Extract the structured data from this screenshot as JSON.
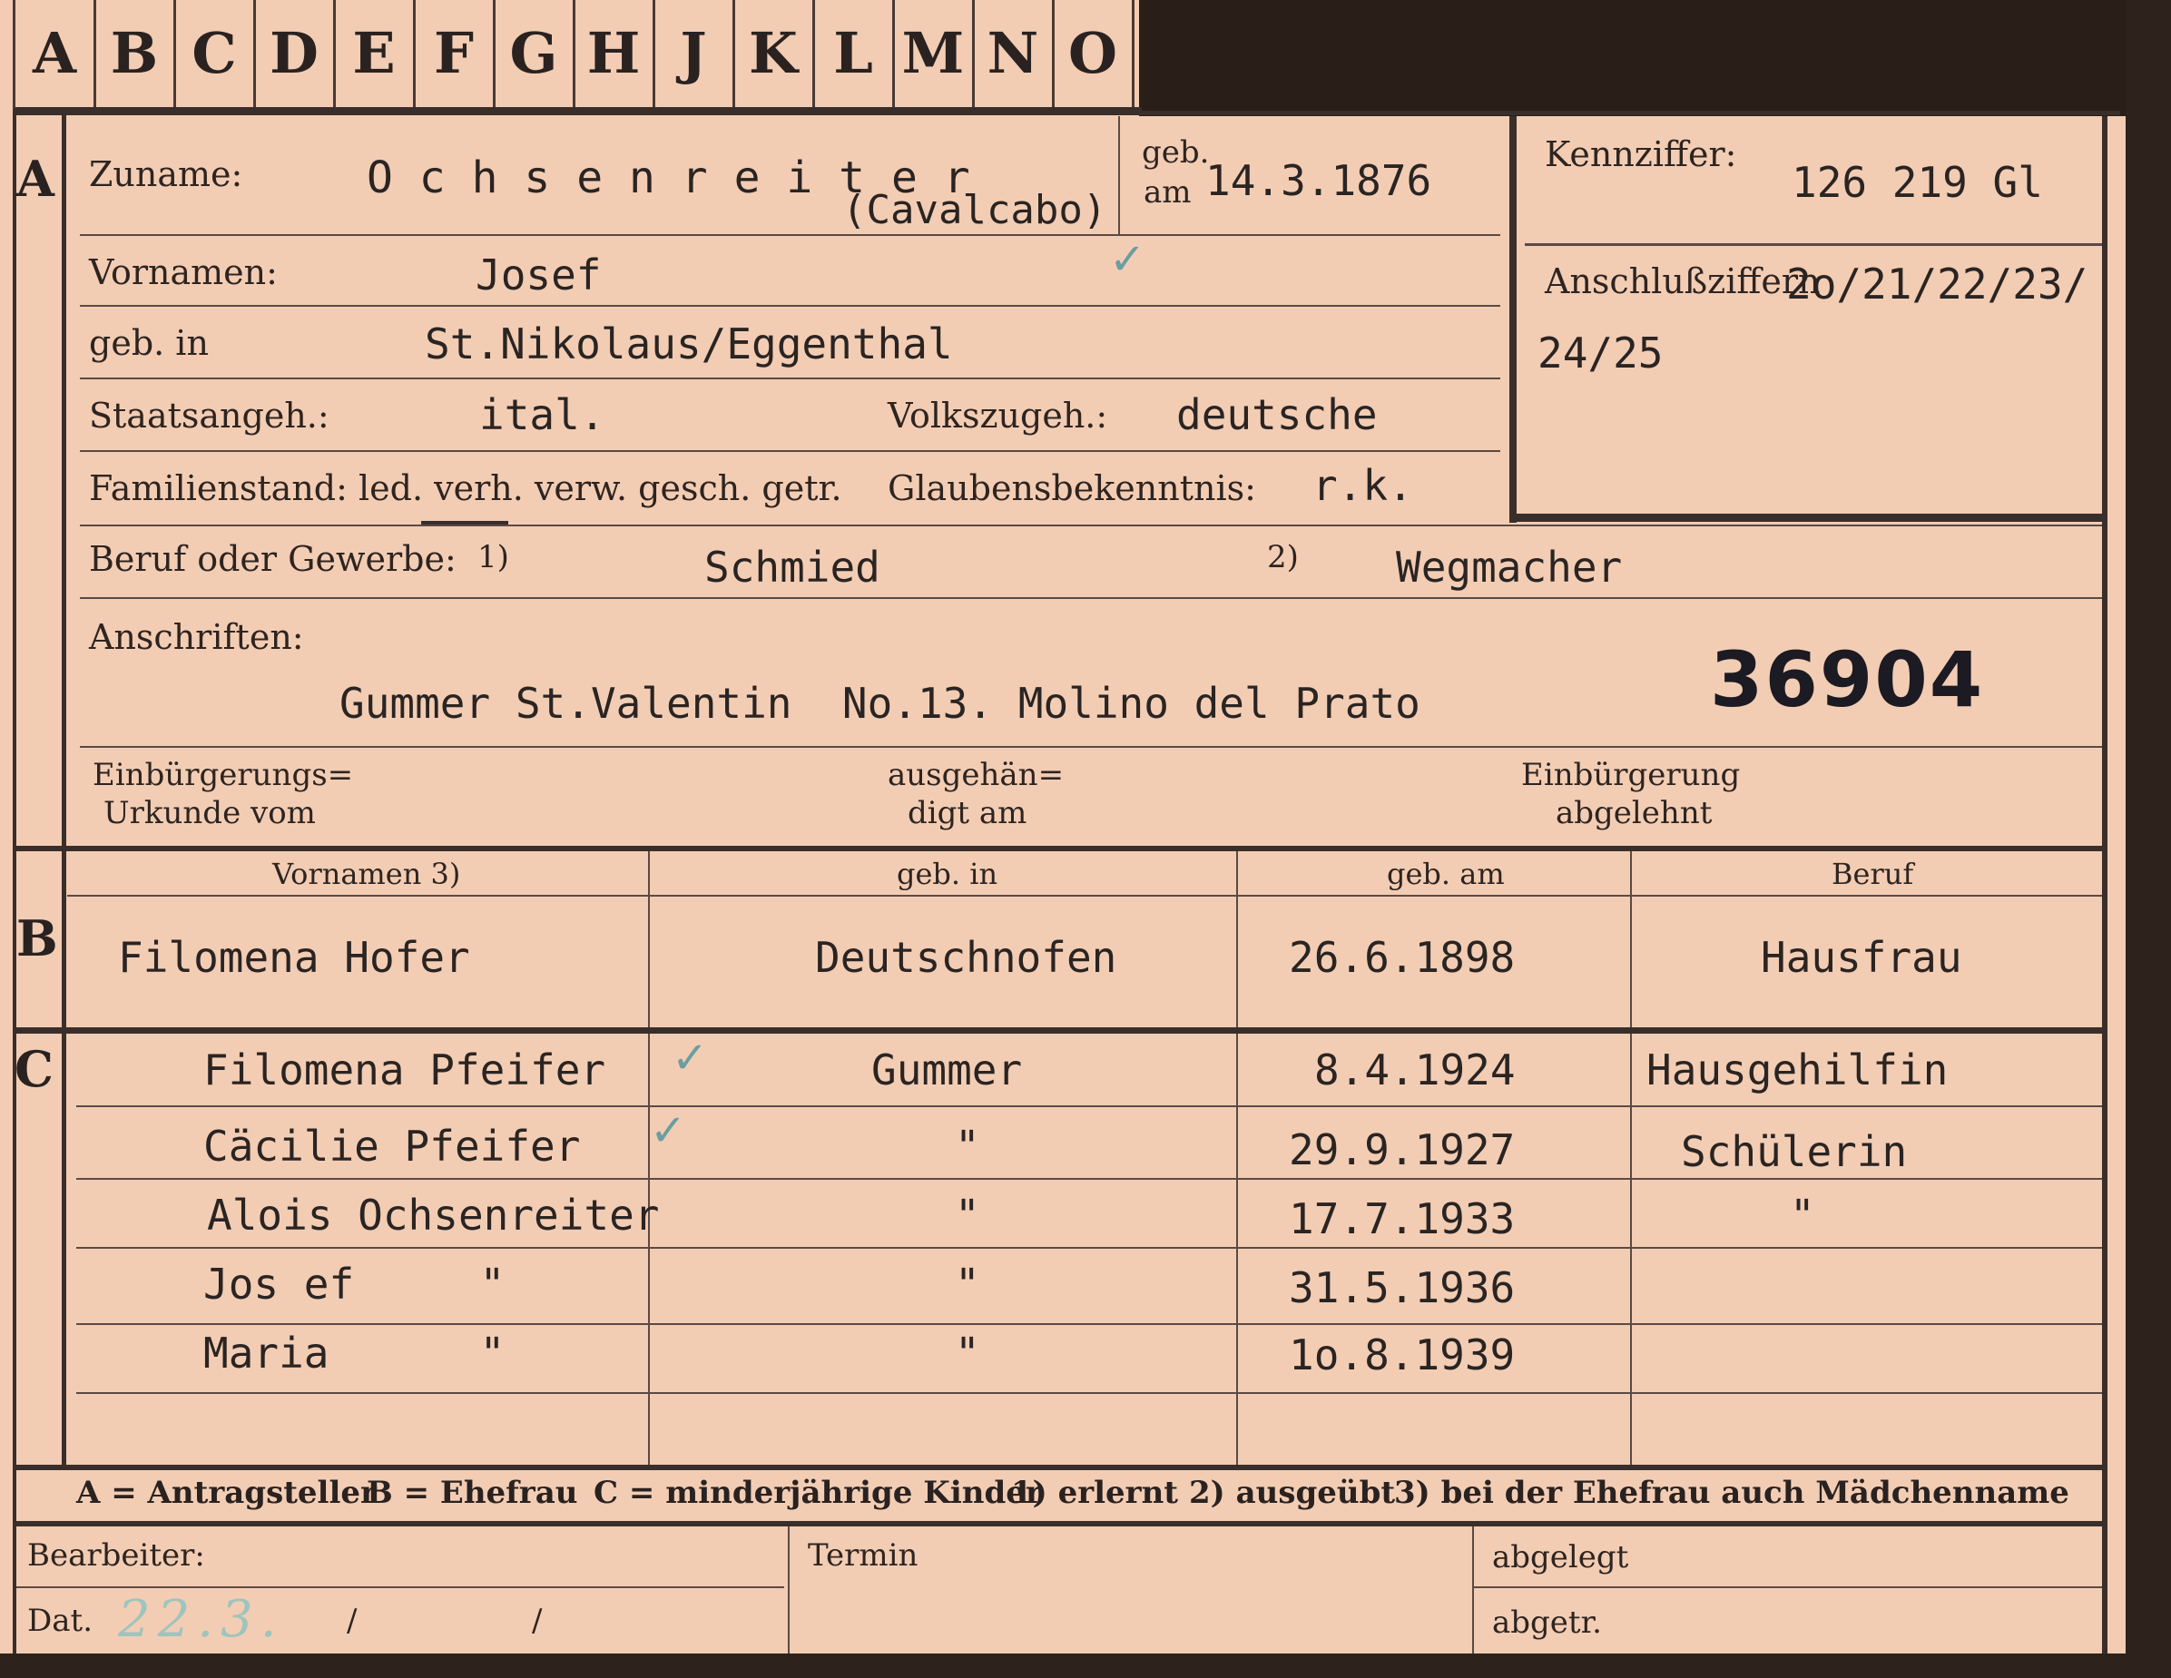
{
  "tabs": [
    "A",
    "B",
    "C",
    "D",
    "E",
    "F",
    "G",
    "H",
    "J",
    "K",
    "L",
    "M",
    "N",
    "O"
  ],
  "sections": {
    "a": "A",
    "b": "B",
    "c": "C"
  },
  "applicant": {
    "surname_label": "Zuname:",
    "surname": "O c h s e n r e i t e r",
    "surname_alt": "(Cavalcabo)",
    "born_on_label_1": "geb.",
    "born_on_label_2": "am",
    "born_on": "14.3.1876",
    "given_names_label": "Vornamen:",
    "given_names": "Josef",
    "birthplace_label": "geb. in",
    "birthplace": "St.Nikolaus/Eggenthal",
    "citizenship_label": "Staatsangeh.:",
    "citizenship": "ital.",
    "ethnicity_label": "Volkszugeh.:",
    "ethnicity": "deutsche",
    "marital_label": "Familienstand: led. verh. verw. gesch. getr.",
    "religion_label": "Glaubensbekenntnis:",
    "religion": "r.k.",
    "occupation_label": "Beruf oder Gewerbe:",
    "occ_mark_1": "1)",
    "occupation_1": "Schmied",
    "occ_mark_2": "2)",
    "occupation_2": "Wegmacher",
    "addresses_label": "Anschriften:",
    "address": "Gummer St.Valentin  No.13. Molino del Prato",
    "stamp_number": "36904",
    "naturalization_1": "Einbürgerungs=",
    "naturalization_2": "Urkunde vom",
    "handed_1": "ausgehän=",
    "handed_2": "digt am",
    "rejected_1": "Einbürgerung",
    "rejected_2": "abgelehnt"
  },
  "reference": {
    "label": "Kennziffer:",
    "value": "126 219  Gl",
    "connect_label": "Anschlußziffern",
    "connect_value_1": "2o/21/22/23/",
    "connect_value_2": "24/25"
  },
  "wife_headers": {
    "given": "Vornamen 3)",
    "place": "geb. in",
    "date": "geb. am",
    "occupation": "Beruf"
  },
  "wife": {
    "given": "Filomena Hofer",
    "place": "Deutschnofen",
    "date": "26.6.1898",
    "occupation": "Hausfrau"
  },
  "children": [
    {
      "name": "Filomena Pfeifer",
      "place": "Gummer",
      "date": "8.4.1924",
      "occupation": "Hausgehilfin"
    },
    {
      "name": "Cäcilie Pfeifer",
      "place": "\"",
      "date": "29.9.1927",
      "occupation": "Schülerin"
    },
    {
      "name": "Alois Ochsenreiter",
      "place": "\"",
      "date": "17.7.1933",
      "occupation": "\""
    },
    {
      "name": "Jos ef     \"",
      "place": "\"",
      "date": "31.5.1936",
      "occupation": ""
    },
    {
      "name": "Maria      \"",
      "place": "\"",
      "date": "1o.8.1939",
      "occupation": ""
    }
  ],
  "legend": {
    "a": "A = Antragsteller",
    "b": "B = Ehefrau",
    "c": "C = minderjährige Kinder",
    "n1": "1) erlernt",
    "n2": "2) ausgeübt",
    "n3": "3) bei der Ehefrau auch Mädchenname"
  },
  "footer": {
    "editor_label": "Bearbeiter:",
    "date_label": "Dat.",
    "date_slash_1": "/",
    "date_slash_2": "/",
    "deadline_label": "Termin",
    "filed_label": "abgelegt",
    "sent_label": "abgetr."
  },
  "colors": {
    "card": "#f2cdb4",
    "ink": "#2a2220",
    "check": "#6a9ea0"
  }
}
